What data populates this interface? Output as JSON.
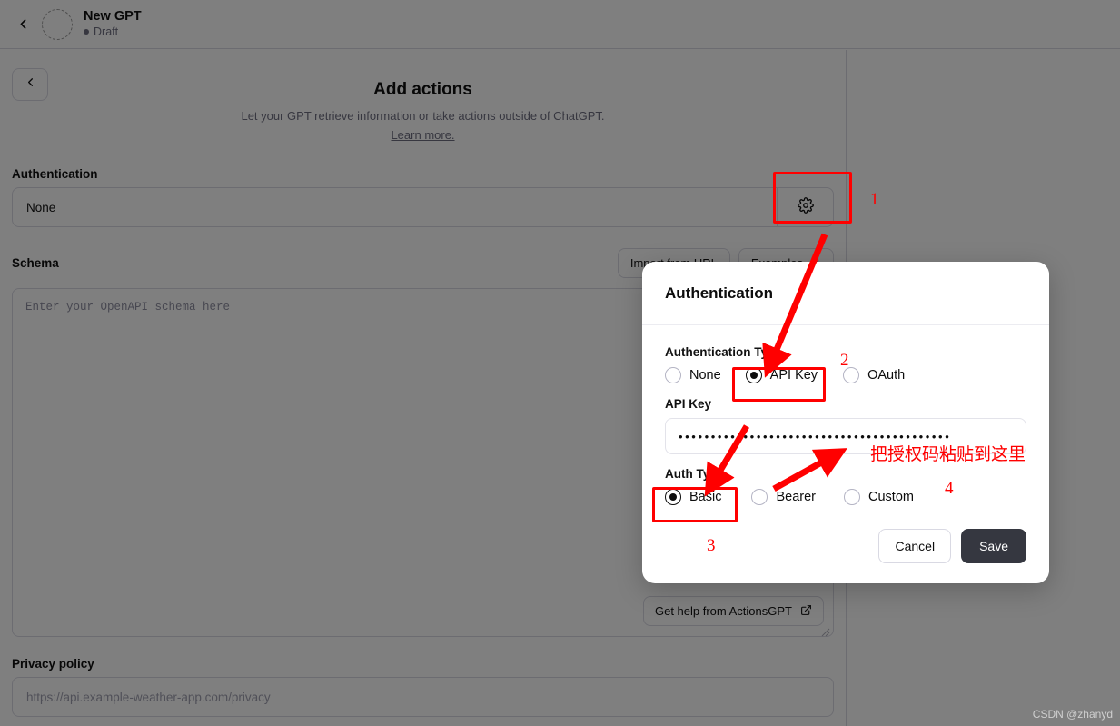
{
  "header": {
    "back_icon": "chevron-left-icon",
    "gpt_name": "New GPT",
    "status": "Draft"
  },
  "main": {
    "back_icon": "chevron-left-icon",
    "title": "Add actions",
    "subtitle_line1": "Let your GPT retrieve information or take actions outside of ChatGPT.",
    "learn_more": "Learn more.",
    "authentication": {
      "label": "Authentication",
      "value": "None",
      "gear_icon": "gear-icon"
    },
    "schema": {
      "label": "Schema",
      "import_button": "Import from URL",
      "examples_button": "Examples",
      "examples_chevron_icon": "chevron-down-icon",
      "placeholder": "Enter your OpenAPI schema here",
      "help_button": "Get help from ActionsGPT",
      "help_external_icon": "external-link-icon"
    },
    "privacy": {
      "label": "Privacy policy",
      "placeholder": "https://api.example-weather-app.com/privacy"
    }
  },
  "modal": {
    "title": "Authentication",
    "auth_type": {
      "label": "Authentication Type",
      "options": [
        {
          "label": "None",
          "checked": false
        },
        {
          "label": "API Key",
          "checked": true
        },
        {
          "label": "OAuth",
          "checked": false
        }
      ]
    },
    "api_key": {
      "label": "API Key",
      "value": "••••••••••••••••••••••••••••••••••••••••••"
    },
    "auth_subtype": {
      "label": "Auth Type",
      "options": [
        {
          "label": "Basic",
          "checked": true
        },
        {
          "label": "Bearer",
          "checked": false
        },
        {
          "label": "Custom",
          "checked": false
        }
      ]
    },
    "cancel_label": "Cancel",
    "save_label": "Save"
  },
  "annotations": {
    "color": "#ff0000",
    "numbers": [
      "1",
      "2",
      "3",
      "4"
    ],
    "note_cn": "把授权码粘贴到这里"
  },
  "watermark": "CSDN @zhanyd"
}
